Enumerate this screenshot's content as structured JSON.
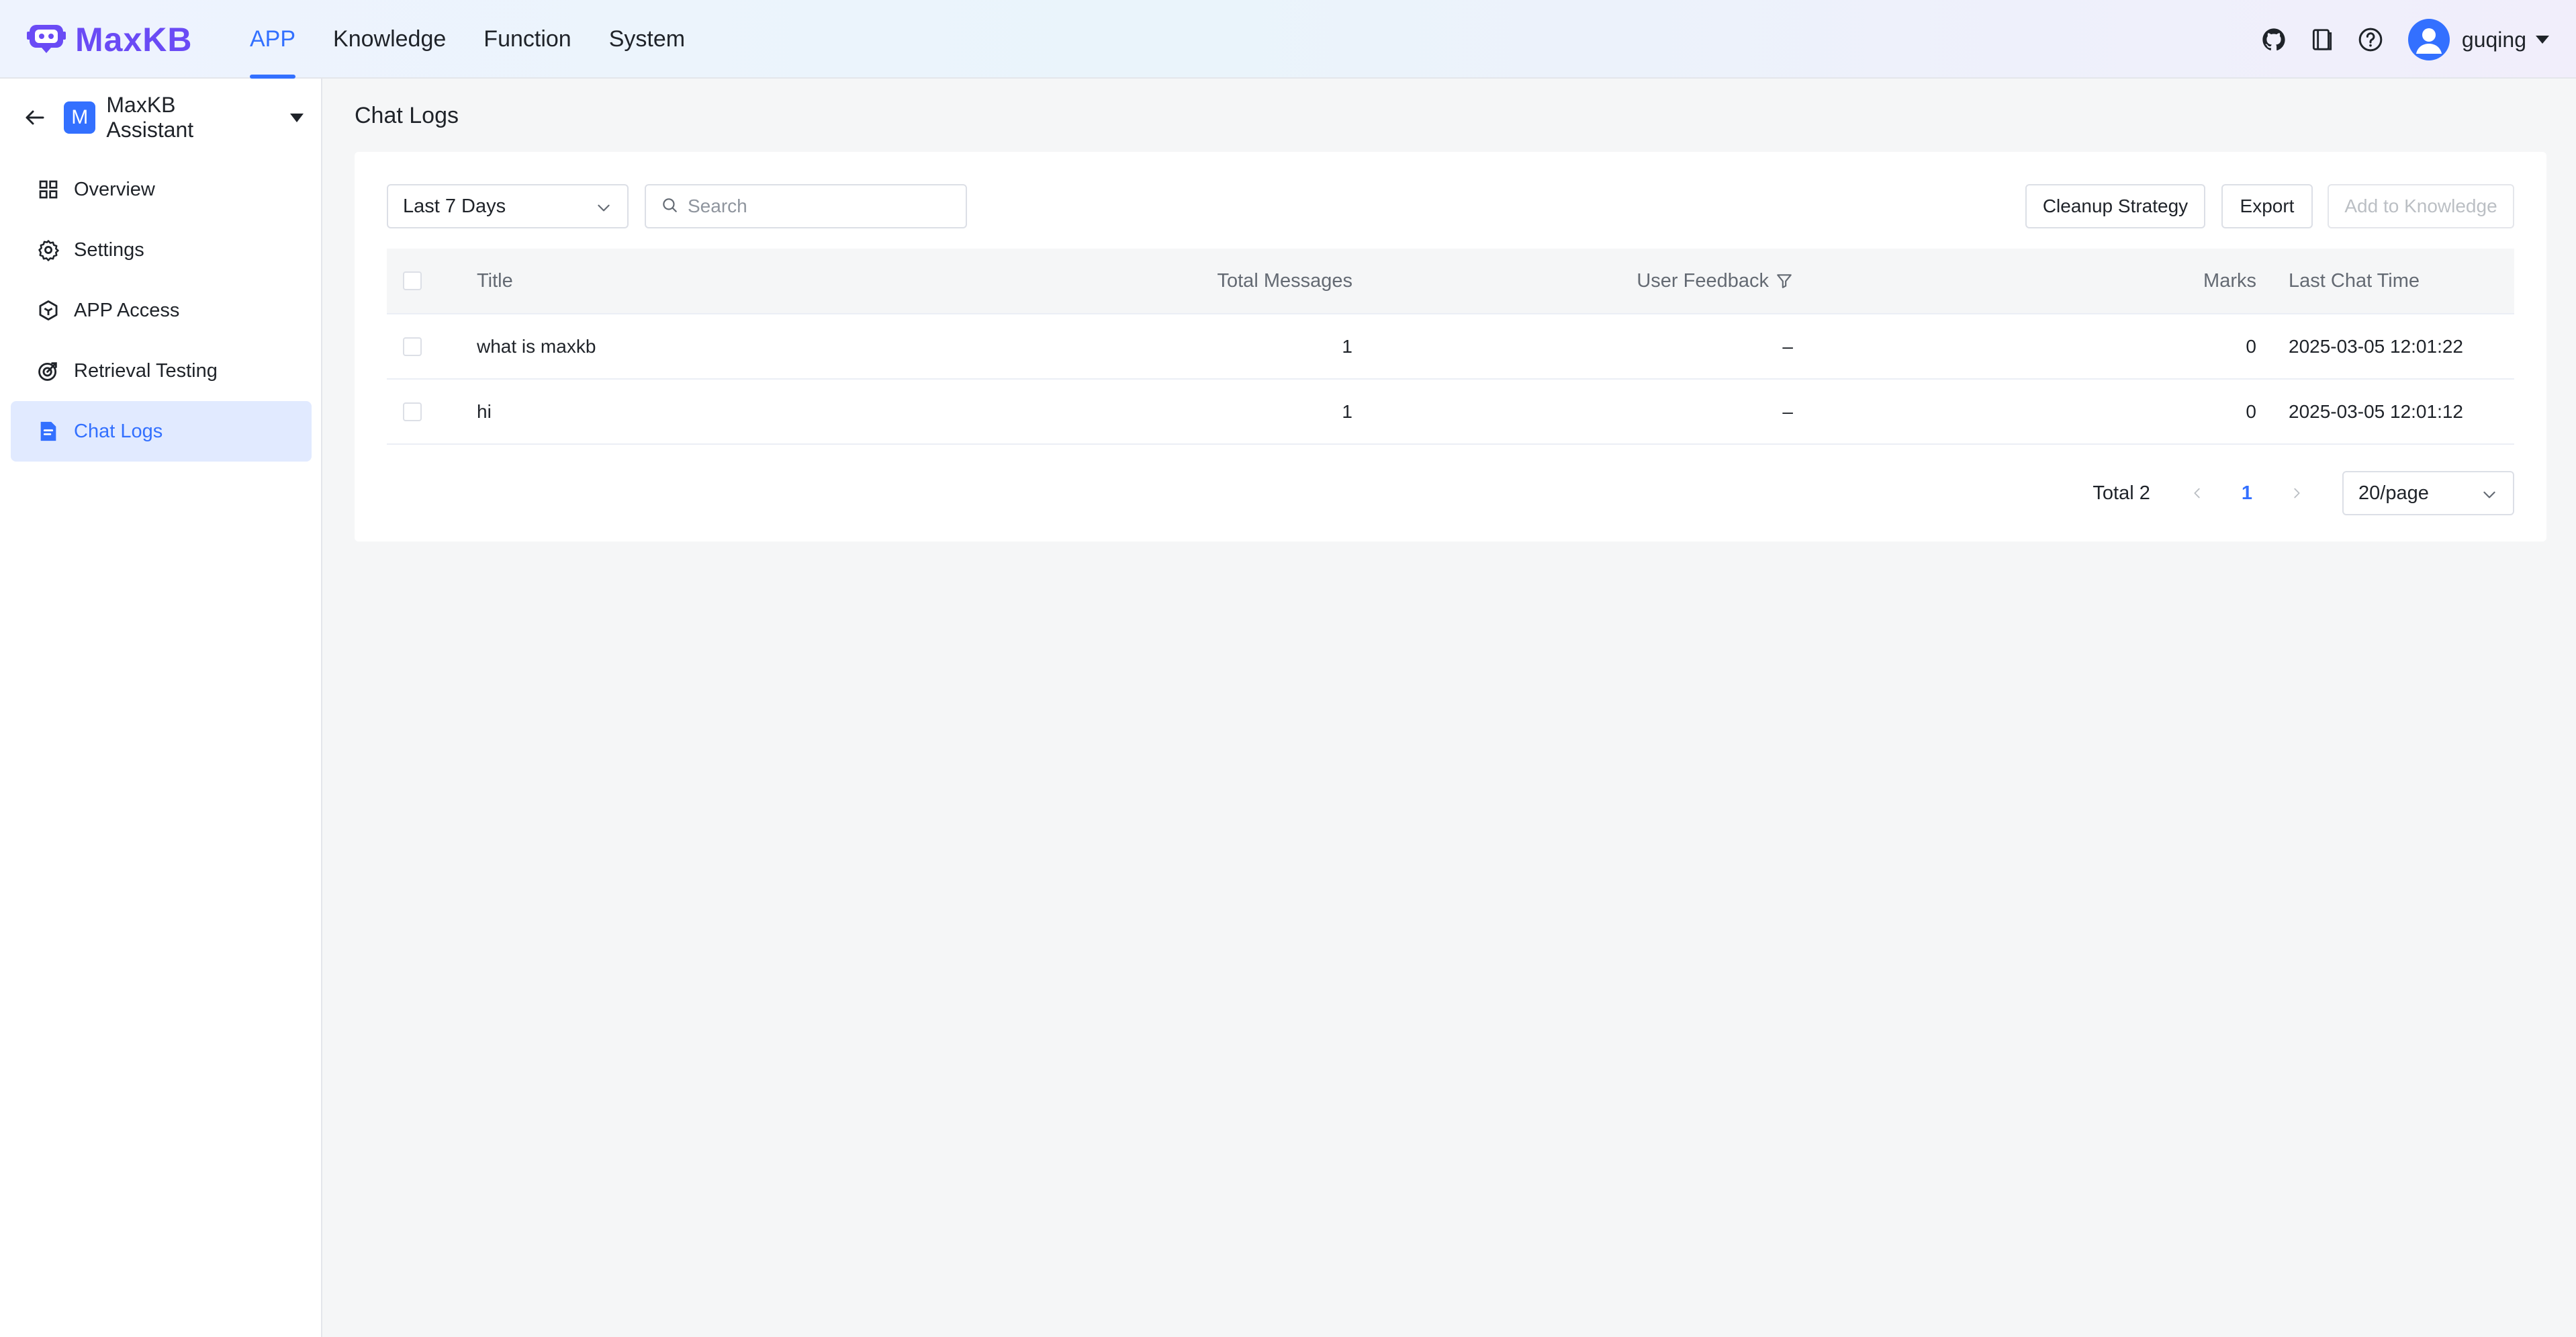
{
  "brand": {
    "name": "MaxKB",
    "accent": "#3370ff",
    "logo_color": "#6a4bf5"
  },
  "nav": {
    "items": [
      {
        "label": "APP",
        "active": true
      },
      {
        "label": "Knowledge",
        "active": false
      },
      {
        "label": "Function",
        "active": false
      },
      {
        "label": "System",
        "active": false
      }
    ]
  },
  "header_right": {
    "icons": [
      "github-icon",
      "document-icon",
      "help-icon"
    ],
    "username": "guqing"
  },
  "sidebar": {
    "app_badge": "M",
    "app_name": "MaxKB Assistant",
    "items": [
      {
        "label": "Overview",
        "icon": "grid-icon",
        "active": false
      },
      {
        "label": "Settings",
        "icon": "gear-icon",
        "active": false
      },
      {
        "label": "APP Access",
        "icon": "cube-icon",
        "active": false
      },
      {
        "label": "Retrieval Testing",
        "icon": "target-icon",
        "active": false
      },
      {
        "label": "Chat Logs",
        "icon": "file-icon",
        "active": true
      }
    ]
  },
  "page": {
    "title": "Chat Logs"
  },
  "toolbar": {
    "date_range": "Last 7 Days",
    "search_placeholder": "Search",
    "cleanup_label": "Cleanup Strategy",
    "export_label": "Export",
    "add_knowledge_label": "Add to Knowledge"
  },
  "table": {
    "headers": {
      "title": "Title",
      "total_messages": "Total Messages",
      "user_feedback": "User Feedback",
      "marks": "Marks",
      "last_chat_time": "Last Chat Time"
    },
    "rows": [
      {
        "title": "what is maxkb",
        "total_messages": "1",
        "user_feedback": "–",
        "marks": "0",
        "last_chat_time": "2025-03-05 12:01:22"
      },
      {
        "title": "hi",
        "total_messages": "1",
        "user_feedback": "–",
        "marks": "0",
        "last_chat_time": "2025-03-05 12:01:12"
      }
    ]
  },
  "pagination": {
    "total_text": "Total 2",
    "current_page": "1",
    "page_size": "20/page"
  }
}
